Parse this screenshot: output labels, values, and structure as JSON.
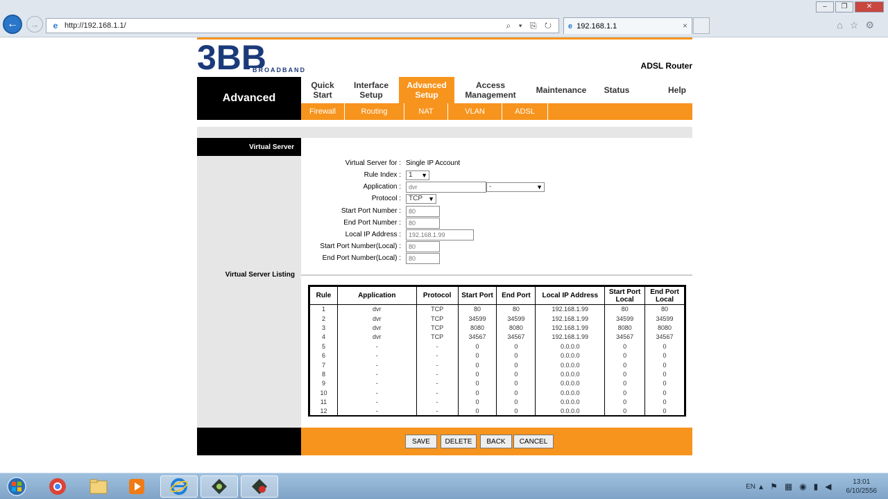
{
  "browser": {
    "url": "http://192.168.1.1/",
    "tab_title": "192.168.1.1",
    "tab_close": "×",
    "address_tools": "⌕ ▾ ⎘ ↻",
    "back_glyph": "←",
    "forward_glyph": "→",
    "icons": [
      "home-icon",
      "favorites-icon",
      "tools-icon"
    ]
  },
  "header": {
    "logo_text": "3BB",
    "logo_sub": "BROADBAND",
    "product": "ADSL Router",
    "section": "Advanced"
  },
  "menu": {
    "items": [
      "Quick Start",
      "Interface Setup",
      "Advanced Setup",
      "Access Management",
      "Maintenance",
      "Status",
      "Help"
    ],
    "active_index": 2,
    "sub_items": [
      "Firewall",
      "Routing",
      "NAT",
      "VLAN",
      "ADSL"
    ]
  },
  "virtual_server": {
    "section_label": "Virtual Server",
    "for_label": "Virtual Server for :",
    "for_value": "Single IP Account",
    "rule_index_label": "Rule Index :",
    "rule_index_value": "1",
    "application_label": "Application :",
    "application_value": "dvr",
    "application_select_value": "-",
    "protocol_label": "Protocol :",
    "protocol_value": "TCP",
    "start_port_label": "Start Port Number :",
    "start_port_value": "80",
    "end_port_label": "End Port Number :",
    "end_port_value": "80",
    "local_ip_label": "Local IP Address :",
    "local_ip_value": "192.168.1.99",
    "start_port_local_label": "Start Port Number(Local) :",
    "start_port_local_value": "80",
    "end_port_local_label": "End Port Number(Local) :",
    "end_port_local_value": "80"
  },
  "listing": {
    "label": "Virtual Server Listing",
    "headers": [
      "Rule",
      "Application",
      "Protocol",
      "Start Port",
      "End Port",
      "Local IP Address",
      "Start Port Local",
      "End Port Local"
    ],
    "rows": [
      [
        "1",
        "dvr",
        "TCP",
        "80",
        "80",
        "192.168.1.99",
        "80",
        "80"
      ],
      [
        "2",
        "dvr",
        "TCP",
        "34599",
        "34599",
        "192.168.1.99",
        "34599",
        "34599"
      ],
      [
        "3",
        "dvr",
        "TCP",
        "8080",
        "8080",
        "192.168.1.99",
        "8080",
        "8080"
      ],
      [
        "4",
        "dvr",
        "TCP",
        "34567",
        "34567",
        "192.168.1.99",
        "34567",
        "34567"
      ],
      [
        "5",
        "-",
        "-",
        "0",
        "0",
        "0.0.0.0",
        "0",
        "0"
      ],
      [
        "6",
        "-",
        "-",
        "0",
        "0",
        "0.0.0.0",
        "0",
        "0"
      ],
      [
        "7",
        "-",
        "-",
        "0",
        "0",
        "0.0.0.0",
        "0",
        "0"
      ],
      [
        "8",
        "-",
        "-",
        "0",
        "0",
        "0.0.0.0",
        "0",
        "0"
      ],
      [
        "9",
        "-",
        "-",
        "0",
        "0",
        "0.0.0.0",
        "0",
        "0"
      ],
      [
        "10",
        "-",
        "-",
        "0",
        "0",
        "0.0.0.0",
        "0",
        "0"
      ],
      [
        "11",
        "-",
        "-",
        "0",
        "0",
        "0.0.0.0",
        "0",
        "0"
      ],
      [
        "12",
        "-",
        "-",
        "0",
        "0",
        "0.0.0.0",
        "0",
        "0"
      ]
    ]
  },
  "buttons": {
    "save": "SAVE",
    "delete": "DELETE",
    "back": "BACK",
    "cancel": "CANCEL"
  },
  "taskbar": {
    "items": [
      "start-orb",
      "chrome-browser",
      "file-explorer",
      "media-player",
      "internet-explorer",
      "app-1",
      "app-2"
    ],
    "language": "EN",
    "time": "13:01",
    "date": "6/10/2556"
  },
  "colors": {
    "accent": "#f7941d",
    "logo_blue": "#1b3a7a"
  }
}
